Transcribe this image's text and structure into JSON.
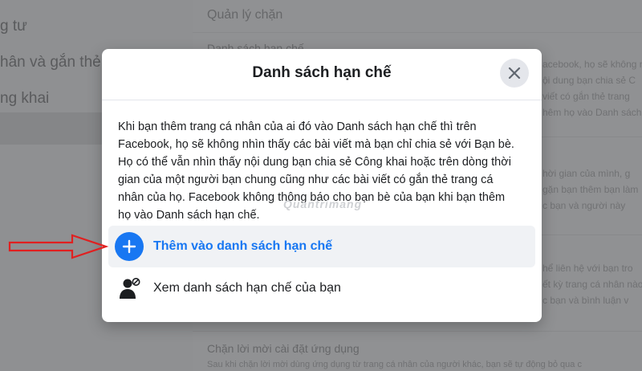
{
  "background": {
    "left_nav": [
      {
        "label": "g tư"
      },
      {
        "label": "hân và gắn thẻ"
      },
      {
        "label": "ng khai"
      }
    ],
    "sections": {
      "manage_block_title": "Quản lý chặn",
      "restricted_list_title": "Danh sách hạn chế",
      "restricted_desc": [
        "acebook, họ sẽ không n",
        "ội dung bạn chia sẻ C",
        "viết có gắn thẻ trang",
        "hêm họ vào Danh sách"
      ],
      "mid_desc": [
        "hời gian của mình, g",
        "gặn bạn thêm bạn làm",
        "c bạn và người này"
      ],
      "lower_desc": [
        "hể liên hệ với bạn tro",
        "ết kỳ trang cá nhân nào",
        "c bạn và bình luận v"
      ],
      "block_app_title": "Chặn lời mời cài đặt ứng dụng",
      "block_app_desc": "Sau khi chặn lời mời dùng ứng dụng từ trang cá nhân của người khác, bạn sẽ tự động bỏ qua c"
    }
  },
  "modal": {
    "title": "Danh sách hạn chế",
    "body": "Khi bạn thêm trang cá nhân của ai đó vào Danh sách hạn chế thì trên Facebook, họ sẽ không nhìn thấy các bài viết mà bạn chỉ chia sẻ với Bạn bè. Họ có thể vẫn nhìn thấy nội dung bạn chia sẻ Công khai hoặc trên dòng thời gian của một người bạn chung cũng như các bài viết có gắn thẻ trang cá nhân của họ. Facebook không thông báo cho bạn bè của bạn khi bạn thêm họ vào Danh sách hạn chế.",
    "watermark": "Quantrimang",
    "options": [
      {
        "label": "Thêm vào danh sách hạn chế",
        "icon": "plus-icon"
      },
      {
        "label": "Xem danh sách hạn chế của bạn",
        "icon": "user-restricted-icon"
      }
    ]
  },
  "colors": {
    "accent": "#1877f2",
    "annotation_arrow": "#e02020"
  }
}
